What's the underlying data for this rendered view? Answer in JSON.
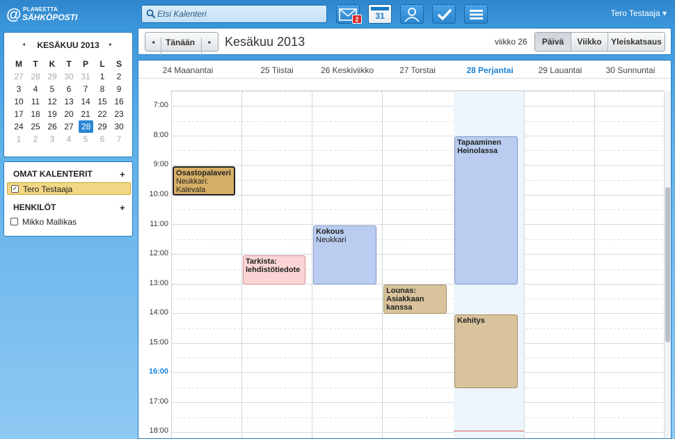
{
  "app": {
    "brand_line1": "PLANEETTA",
    "brand_line2": "SÄHKÖPOSTI"
  },
  "search": {
    "placeholder": "Etsi Kalenteri"
  },
  "topnav": {
    "mail_badge": "2",
    "calendar_day": "31"
  },
  "user": {
    "name": "Tero Testaaja",
    "menu_arrow": "▾"
  },
  "minical": {
    "title": "KESÄKUU 2013",
    "prev": "◂",
    "next": "▸",
    "weekdays": [
      "M",
      "T",
      "K",
      "T",
      "P",
      "L",
      "S"
    ],
    "weeks": [
      [
        "27",
        "28",
        "29",
        "30",
        "31",
        "1",
        "2"
      ],
      [
        "3",
        "4",
        "5",
        "6",
        "7",
        "8",
        "9"
      ],
      [
        "10",
        "11",
        "12",
        "13",
        "14",
        "15",
        "16"
      ],
      [
        "17",
        "18",
        "19",
        "20",
        "21",
        "22",
        "23"
      ],
      [
        "24",
        "25",
        "26",
        "27",
        "28",
        "29",
        "30"
      ],
      [
        "1",
        "2",
        "3",
        "4",
        "5",
        "6",
        "7"
      ]
    ],
    "selected": "28"
  },
  "sidebar": {
    "my_calendars_title": "OMAT KALENTERIT",
    "people_title": "HENKILÖT",
    "add_symbol": "+",
    "my_calendars": [
      {
        "label": "Tero Testaaja",
        "checked": true
      }
    ],
    "people": [
      {
        "label": "Mikko Mallikas",
        "checked": false
      }
    ]
  },
  "toolbar": {
    "prev": "◂",
    "today": "Tänään",
    "next": "▸",
    "title": "Kesäkuu 2013",
    "week": "viikko 26",
    "views": [
      "Päivä",
      "Viikko",
      "Yleiskatsaus"
    ],
    "active_view": "Päivä"
  },
  "days": [
    "24 Maanantai",
    "25 Tiistai",
    "26 Keskiviikko",
    "27 Torstai",
    "28 Perjantai",
    "29 Lauantai",
    "30 Sunnuntai"
  ],
  "today_index": 4,
  "hours": [
    "7:00",
    "8:00",
    "9:00",
    "10:00",
    "11:00",
    "12:00",
    "13:00",
    "14:00",
    "15:00",
    "16:00",
    "17:00",
    "18:00"
  ],
  "current_hour_label": "16:00",
  "now_time": "16:45",
  "events": {
    "e1": {
      "title": "Osastopalaveri",
      "location": "Neukkari: Kalevala",
      "day": 0,
      "start": "8:00",
      "end": "9:00",
      "color": "#d6ae66"
    },
    "e2": {
      "title": "Tarkista: lehdistötiedote",
      "location": "",
      "day": 1,
      "start": "11:00",
      "end": "12:00",
      "color": "#fbd5d6"
    },
    "e3": {
      "title": "Kokous",
      "location": "Neukkari",
      "day": 2,
      "start": "10:00",
      "end": "12:00",
      "color": "#bacdf0"
    },
    "e4": {
      "title": "Lounas: Asiakkaan kanssa",
      "location": "",
      "day": 3,
      "start": "12:00",
      "end": "13:00",
      "color": "#d8c39c"
    },
    "e5": {
      "title": "Tapaaminen Heinolassa",
      "location": "",
      "day": 4,
      "start": "7:00",
      "end": "12:00",
      "color": "#bacdf0"
    },
    "e6": {
      "title": "Kehitys",
      "location": "",
      "day": 4,
      "start": "13:00",
      "end": "15:30",
      "color": "#d8c39c"
    }
  },
  "colors": {
    "accent": "#1a84d8",
    "selected_day": "#2b86d6",
    "now_line": "#e05555"
  }
}
